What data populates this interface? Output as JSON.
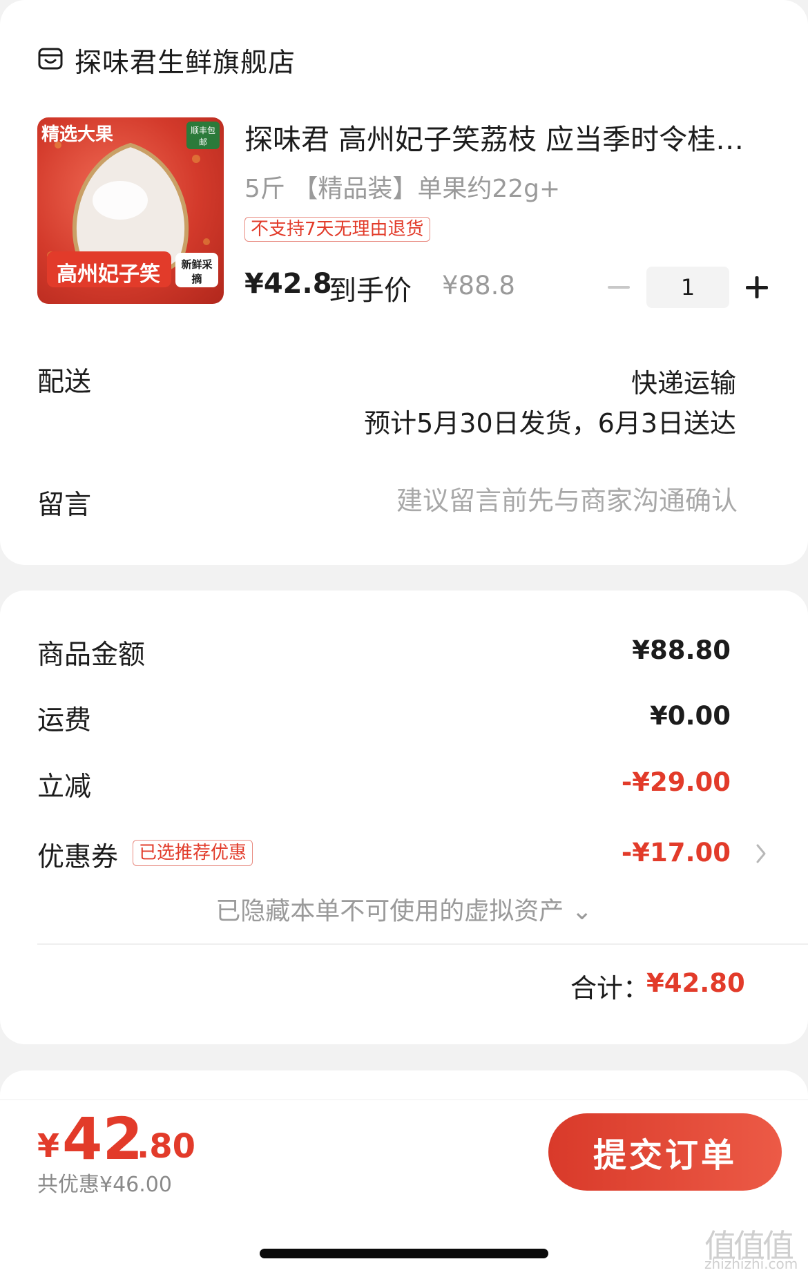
{
  "store": {
    "name": "探味君生鲜旗舰店",
    "icon": "store-icon"
  },
  "product": {
    "image_badges": {
      "top_left": "精选大果",
      "top_right": "顺丰包邮",
      "bottom": "高州妃子笑",
      "bottom_right": "新鲜采摘"
    },
    "title": "探味君 高州妃子笑荔枝 应当季时令桂…",
    "spec": "5斤 【精品装】单果约22g+",
    "return_badge": "不支持7天无理由退货",
    "price_final": "¥42.8",
    "price_final_label": "到手价",
    "price_original": "¥88.8",
    "quantity": "1"
  },
  "delivery": {
    "label": "配送",
    "method": "快递运输",
    "estimate": "预计5月30日发货，6月3日送达"
  },
  "message": {
    "label": "留言",
    "placeholder": "建议留言前先与商家沟通确认"
  },
  "summary": {
    "goods_label": "商品金额",
    "goods_value": "¥88.80",
    "shipping_label": "运费",
    "shipping_value": "¥0.00",
    "discount_label": "立减",
    "discount_value": "-¥29.00",
    "coupon_label": "优惠券",
    "coupon_badge": "已选推荐优惠",
    "coupon_value": "-¥17.00",
    "hidden_assets": "已隐藏本单不可使用的虚拟资产 ⌄",
    "total_label": "合计：",
    "total_value": "¥42.80"
  },
  "bottom_bar": {
    "pay_currency": "¥",
    "pay_integer": "42",
    "pay_decimal": ".80",
    "saved_text": "共优惠¥46.00",
    "submit_label": "提交订单"
  },
  "watermark": {
    "mark": "值值值",
    "url": "zhizhizhi.com"
  },
  "colors": {
    "accent": "#e23b2a",
    "muted": "#9a9a9a"
  }
}
